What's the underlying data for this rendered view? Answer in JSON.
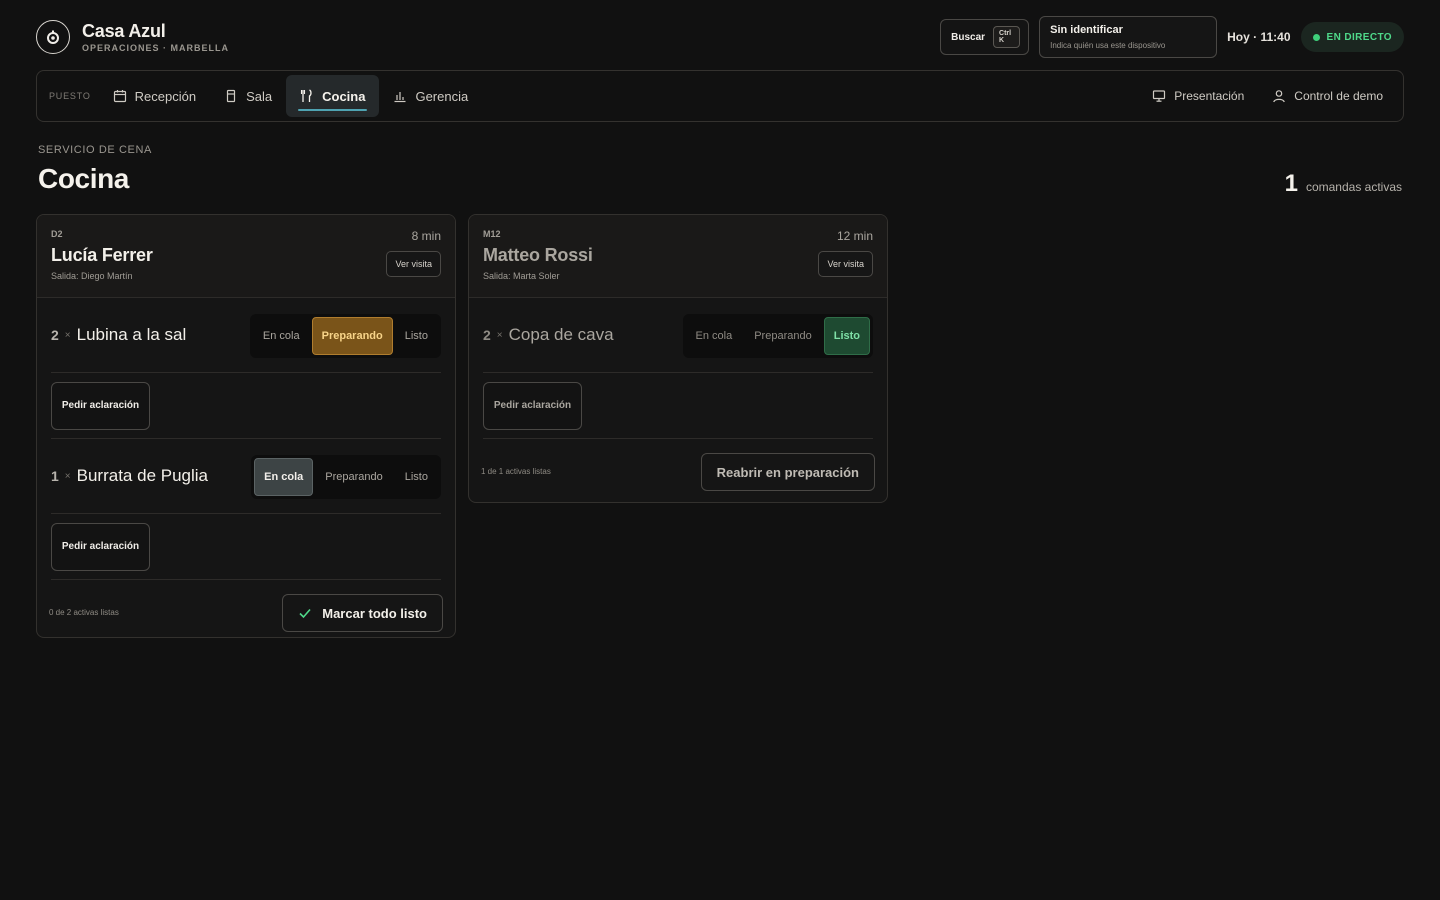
{
  "brand": {
    "name": "Casa Azul",
    "subtitle": "OPERACIONES · MARBELLA"
  },
  "header": {
    "search_label": "Buscar",
    "search_shortcut": "Ctrl K",
    "identify_title": "Sin identificar",
    "identify_sub": "Indica quién usa este dispositivo",
    "clock": "Hoy · 11:40",
    "live_label": "EN DIRECTO"
  },
  "nav": {
    "label": "PUESTO",
    "items": [
      {
        "label": "Recepción",
        "icon": "calendar-icon"
      },
      {
        "label": "Sala",
        "icon": "door-icon"
      },
      {
        "label": "Cocina",
        "icon": "utensils-icon",
        "active": true
      },
      {
        "label": "Gerencia",
        "icon": "bar-chart-icon"
      }
    ],
    "right": [
      {
        "label": "Presentación",
        "icon": "monitor-icon"
      },
      {
        "label": "Control de demo",
        "icon": "user-icon"
      }
    ]
  },
  "page": {
    "eyebrow": "SERVICIO DE CENA",
    "title": "Cocina",
    "active_count": "1",
    "active_label": "comandas activas"
  },
  "status_labels": {
    "queued": "En cola",
    "preparing": "Preparando",
    "done": "Listo"
  },
  "cards": [
    {
      "table": "D2",
      "guest": "Lucía Ferrer",
      "exit": "Salida: Diego Martín",
      "elapsed": "8 min",
      "view_label": "Ver visita",
      "items": [
        {
          "qty": "2",
          "name": "Lubina a la sal",
          "status": "preparing",
          "clarify": "Pedir aclaración"
        },
        {
          "qty": "1",
          "name": "Burrata de Puglia",
          "status": "queued",
          "clarify": "Pedir aclaración"
        }
      ],
      "footer_status": "0 de 2 activas listas",
      "footer_action": "Marcar todo listo"
    },
    {
      "table": "M12",
      "guest": "Matteo Rossi",
      "exit": "Salida: Marta Soler",
      "elapsed": "12 min",
      "view_label": "Ver visita",
      "items": [
        {
          "qty": "2",
          "name": "Copa de cava",
          "status": "done",
          "clarify": "Pedir aclaración"
        }
      ],
      "footer_status": "1 de 1 activas listas",
      "footer_action": "Reabrir en preparación"
    }
  ],
  "colors": {
    "background": "#111111",
    "accent": "#4fa3b2",
    "live": "#4fd98a",
    "preparing": "#7a5419",
    "queued": "#3d4445",
    "done": "#1e4a31"
  }
}
